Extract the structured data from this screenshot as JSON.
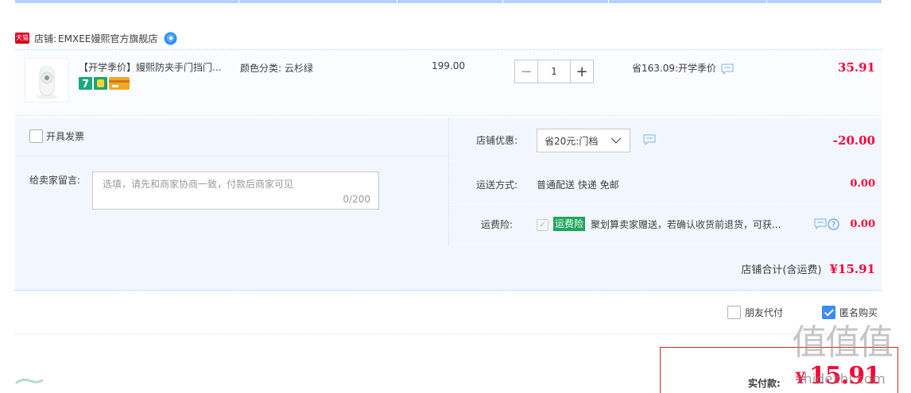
{
  "store": {
    "tag": "天猫",
    "prefix": "店铺:",
    "name": "EMXEE嫚熙官方旗舰店"
  },
  "item": {
    "title": "【开学季价】嫚熙防夹手门挡门...",
    "sku": "颜色分类: 云杉绿",
    "price": "199.00",
    "quantity": "1",
    "quantity_minus": "−",
    "quantity_plus": "+",
    "savings": "省163.09:开学季价",
    "total": "35.91"
  },
  "invoice": {
    "label": "开具发票"
  },
  "note": {
    "label": "给卖家留言:",
    "placeholder": "选填，请先和商家协商一致，付款后商家可见",
    "count": "0/200"
  },
  "coupon": {
    "label": "店铺优惠:",
    "selected": "省20元:门档",
    "value": "-20.00"
  },
  "shipping": {
    "label": "运送方式:",
    "method": "普通配送 快递 免邮",
    "value": "0.00"
  },
  "insurance": {
    "label": "运费险:",
    "tag": "运费险",
    "text": "聚划算卖家赠送，若确认收货前退货，可获...",
    "value": "0.00"
  },
  "store_total": {
    "label": "店铺合计(含运费)",
    "value": "¥15.91"
  },
  "options": {
    "friend_pay": "朋友代付",
    "anonymous": "匿名购买"
  },
  "payment": {
    "label": "实付款:",
    "currency": "¥",
    "value": "15.91"
  },
  "watermark": {
    "glyphs": "值值值",
    "text": "zhidezhi.com"
  },
  "colors": {
    "price_red": "#ff0036",
    "accent_blue": "#3c8bf7",
    "panel_bg": "#f2f7ff",
    "insurance_green": "#1fa55a"
  },
  "icons": [
    "tmall-icon",
    "wangwang-icon",
    "message-icon",
    "help-icon",
    "chevron-down-icon"
  ]
}
